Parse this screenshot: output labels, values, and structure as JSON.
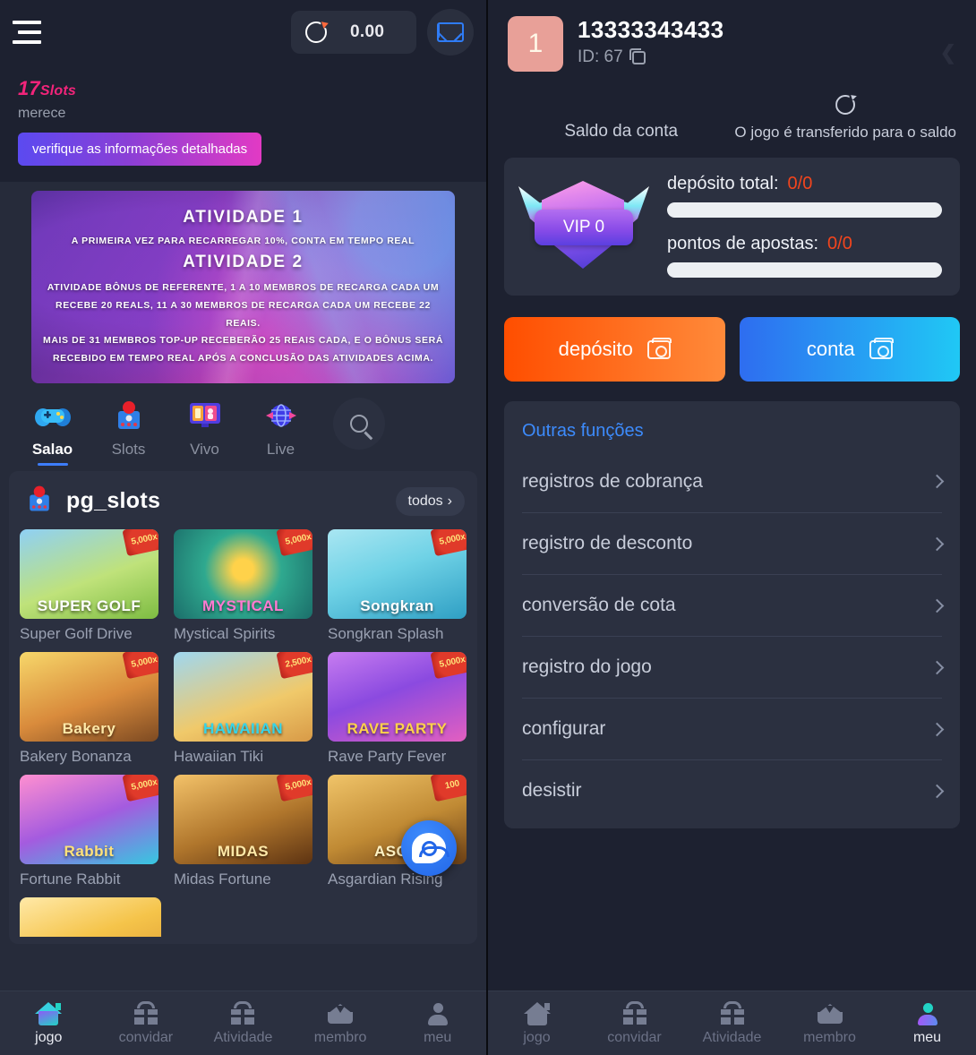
{
  "left": {
    "topbar": {
      "menu_icon": "hamburger-icon",
      "refresh_icon": "refresh-icon",
      "balance": "0.00",
      "mail_icon": "mail-icon"
    },
    "promo": {
      "count": "17",
      "count_suffix": "Slots",
      "subtitle": "merece",
      "button": "verifique as informações detalhadas"
    },
    "banner": {
      "heading1": "ATIVIDADE 1",
      "line1": "A PRIMEIRA VEZ PARA RECARREGAR 10%, CONTA EM TEMPO REAL",
      "heading2": "ATIVIDADE 2",
      "line2": "ATIVIDADE BÔNUS DE REFERENTE, 1 A 10 MEMBROS DE RECARGA CADA UM",
      "line3": "RECEBE 20 REALS, 11 A 30 MEMBROS DE RECARGA CADA UM RECEBE 22 REAIS.",
      "line4": "MAIS DE 31 MEMBROS TOP-UP RECEBERÃO 25 REAIS CADA, E O BÔNUS SERÁ",
      "line5": "RECEBIDO EM TEMPO REAL APÓS A CONCLUSÃO DAS ATIVIDADES ACIMA."
    },
    "categories": [
      {
        "label": "Salao",
        "icon": "gamepad-icon",
        "active": true
      },
      {
        "label": "Slots",
        "icon": "slot-machine-icon",
        "active": false
      },
      {
        "label": "Vivo",
        "icon": "live-casino-icon",
        "active": false
      },
      {
        "label": "Live",
        "icon": "globe-icon",
        "active": false
      }
    ],
    "search_icon": "search-icon",
    "games_section": {
      "icon": "pg-slots-icon",
      "title": "pg_slots",
      "all_label": "todos",
      "games": [
        {
          "name": "Super Golf Drive",
          "multiplier": "5,000x"
        },
        {
          "name": "Mystical Spirits",
          "multiplier": "5,000x"
        },
        {
          "name": "Songkran Splash",
          "multiplier": "5,000x"
        },
        {
          "name": "Bakery Bonanza",
          "multiplier": "5,000x"
        },
        {
          "name": "Hawaiian Tiki",
          "multiplier": "2,500x"
        },
        {
          "name": "Rave Party Fever",
          "multiplier": "5,000x"
        },
        {
          "name": "Fortune Rabbit",
          "multiplier": "5,000x"
        },
        {
          "name": "Midas Fortune",
          "multiplier": "5,000x"
        },
        {
          "name": "Asgardian Rising",
          "multiplier": "100"
        }
      ]
    },
    "support_icon": "customer-service-icon",
    "bottom_nav": [
      {
        "label": "jogo",
        "icon": "home-icon",
        "active": true
      },
      {
        "label": "convidar",
        "icon": "gift-icon",
        "active": false
      },
      {
        "label": "Atividade",
        "icon": "gift-icon",
        "active": false
      },
      {
        "label": "membro",
        "icon": "crown-icon",
        "active": false
      },
      {
        "label": "meu",
        "icon": "user-icon",
        "active": false
      }
    ]
  },
  "right": {
    "account": {
      "avatar_label": "1",
      "username": "13333343433",
      "id_label": "ID: 67",
      "copy_icon": "copy-icon",
      "share_icon": "share-icon"
    },
    "balance": {
      "label": "Saldo da conta",
      "refresh_icon": "refresh-icon",
      "transfer_text": "O jogo é transferido para o saldo"
    },
    "vip": {
      "badge_label": "VIP 0",
      "deposit_label": "depósito total:",
      "deposit_value": "0/0",
      "deposit_progress": 0,
      "points_label": "pontos de apostas:",
      "points_value": "0/0",
      "points_progress": 0
    },
    "actions": {
      "deposit_label": "depósito",
      "deposit_icon": "wallet-icon",
      "account_label": "conta",
      "account_icon": "wallet-icon"
    },
    "functions": {
      "title": "Outras funções",
      "items": [
        {
          "label": "registros de cobrança"
        },
        {
          "label": "registro de desconto"
        },
        {
          "label": "conversão de cota"
        },
        {
          "label": "registro do jogo"
        },
        {
          "label": "configurar"
        },
        {
          "label": "desistir"
        }
      ]
    },
    "bottom_nav": [
      {
        "label": "jogo",
        "icon": "home-icon",
        "active": false
      },
      {
        "label": "convidar",
        "icon": "gift-icon",
        "active": false
      },
      {
        "label": "Atividade",
        "icon": "gift-icon",
        "active": false
      },
      {
        "label": "membro",
        "icon": "crown-icon",
        "active": false
      },
      {
        "label": "meu",
        "icon": "user-icon",
        "active": true
      }
    ]
  },
  "colors": {
    "panel_bg": "#262b3a",
    "card_bg": "#2b3040",
    "dark_bg": "#1d2130",
    "accent_blue": "#3d8bfc",
    "accent_pink": "#f2247a",
    "accent_orange": "#ff4e00",
    "value_red": "#f2451d"
  }
}
